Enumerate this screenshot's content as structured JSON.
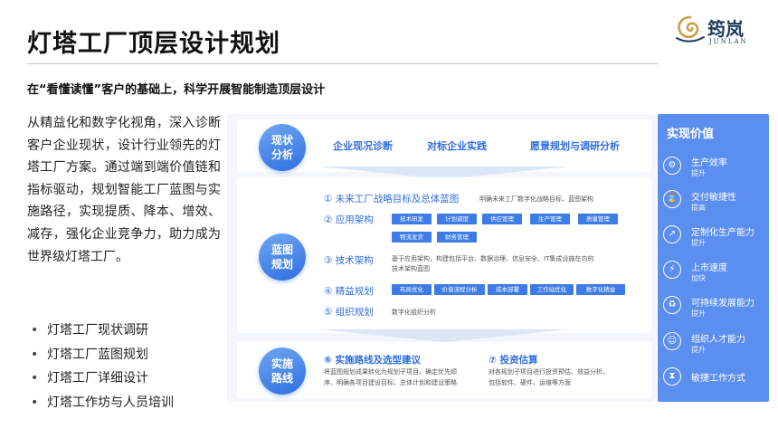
{
  "header": {
    "title": "灯塔工厂顶层设计规划",
    "logo_cn": "筠岚",
    "logo_en": "JUNLAN"
  },
  "subtitle": "在“看懂读懂”客户的基础上，科学开展智能制造顶层设计",
  "lead": "从精益化和数字化视角，深入诊断客户企业现状，设计行业领先的灯塔工厂方案。通过端到端价值链和指标驱动，规划智能工厂蓝图与实施路径，实现提质、降本、增效、减存，强化企业竞争力，助力成为世界级灯塔工厂。",
  "bullets": [
    "灯塔工厂现状调研",
    "灯塔工厂蓝图规划",
    "灯塔工厂详细设计",
    "灯塔工作坊与人员培训"
  ],
  "diagram": {
    "sec1": {
      "circle": [
        "现状",
        "分析"
      ],
      "items": [
        "企业现况诊断",
        "对标企业实践",
        "愿景规划与调研分析"
      ]
    },
    "sec2": {
      "circle": [
        "蓝图",
        "规划"
      ],
      "rows": [
        {
          "label": "① 未来工厂战略目标及总体蓝图",
          "desc": "明确未来工厂数字化战略目标、蓝图架构"
        },
        {
          "label": "② 应用架构",
          "tags": [
            "技术研发",
            "计划调度",
            "供应管理",
            "生产管理",
            "质量管理",
            "物流发货",
            "财务管理"
          ]
        },
        {
          "label": "③ 技术架构",
          "desc1": "基于应用架构，构建包括平台、数据治理、信息安全、IT集成设施在内的",
          "desc2": "技术架构蓝图"
        },
        {
          "label": "④ 精益规划",
          "tags": [
            "布局优化",
            "价值流程分析",
            "成本部署",
            "工作站优化",
            "数字化精益"
          ]
        },
        {
          "label": "⑤ 组织规划",
          "desc": "数字化组织分析"
        }
      ]
    },
    "sec3": {
      "circle": [
        "实施",
        "路线"
      ],
      "left_title": "⑥ 实施路线及选型建议",
      "left_desc": [
        "将蓝图规划成果转化为规划子项目，确定优先顺",
        "序、明确各项目建设目标、总体计划和建设策略"
      ],
      "right_title": "⑦ 投资估算",
      "right_desc": [
        "对各规划子项目进行投资预估、效益分析，",
        "包括软件、硬件、运维等方面"
      ]
    }
  },
  "values": {
    "title": "实现价值",
    "items": [
      {
        "icon": "efficiency-icon",
        "glyph": "⚙",
        "title": "生产效率",
        "sub": "提升"
      },
      {
        "icon": "hourglass-icon",
        "glyph": "⌛",
        "title": "交付敏捷性",
        "sub": "提高"
      },
      {
        "icon": "chart-icon",
        "glyph": "↗",
        "title": "定制化生产能力",
        "sub": "提升"
      },
      {
        "icon": "speed-icon",
        "glyph": "⚡",
        "title": "上市速度",
        "sub": "加快"
      },
      {
        "icon": "leaf-icon",
        "glyph": "♻",
        "title": "可持续发展能力",
        "sub": "提升"
      },
      {
        "icon": "people-icon",
        "glyph": "☺",
        "title": "组织人才能力",
        "sub": "提升"
      },
      {
        "icon": "clock-icon",
        "glyph": "⧗",
        "title": "敏捷工作方式",
        "sub": ""
      }
    ]
  }
}
